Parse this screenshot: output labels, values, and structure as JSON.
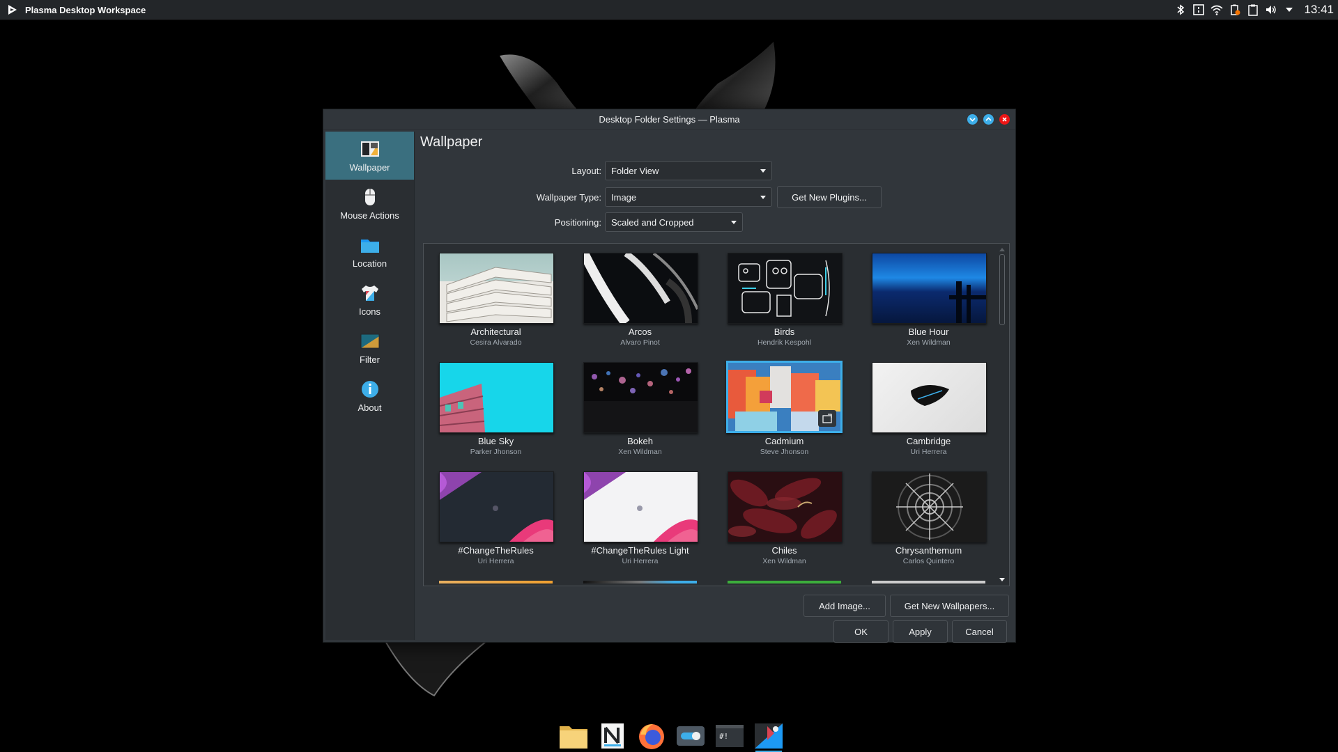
{
  "panel": {
    "app_title": "Plasma Desktop Workspace",
    "clock": "13:41",
    "tray_icons": [
      "bluetooth-icon",
      "notes-icon",
      "wifi-icon",
      "battery-icon",
      "clipboard-icon",
      "volume-icon",
      "expand-tray-icon"
    ]
  },
  "dialog": {
    "title": "Desktop Folder Settings — Plasma",
    "sidebar": [
      {
        "label": "Wallpaper",
        "icon": "wallpaper-icon",
        "active": true
      },
      {
        "label": "Mouse Actions",
        "icon": "mouse-icon",
        "active": false
      },
      {
        "label": "Location",
        "icon": "folder-icon",
        "active": false
      },
      {
        "label": "Icons",
        "icon": "shirt-icon",
        "active": false
      },
      {
        "label": "Filter",
        "icon": "filter-icon",
        "active": false
      },
      {
        "label": "About",
        "icon": "info-icon",
        "active": false
      }
    ],
    "heading": "Wallpaper",
    "form": {
      "layout_label": "Layout:",
      "layout_value": "Folder View",
      "type_label": "Wallpaper Type:",
      "type_value": "Image",
      "get_plugins": "Get New Plugins...",
      "positioning_label": "Positioning:",
      "positioning_value": "Scaled and Cropped"
    },
    "wallpapers": [
      {
        "name": "Architectural",
        "author": "Cesira Alvarado"
      },
      {
        "name": "Arcos",
        "author": "Alvaro Pinot"
      },
      {
        "name": "Birds",
        "author": "Hendrik Kespohl"
      },
      {
        "name": "Blue Hour",
        "author": "Xen Wildman"
      },
      {
        "name": "Blue Sky",
        "author": "Parker Jhonson"
      },
      {
        "name": "Bokeh",
        "author": "Xen Wildman"
      },
      {
        "name": "Cadmium",
        "author": "Steve Jhonson",
        "selected": true
      },
      {
        "name": "Cambridge",
        "author": "Uri Herrera"
      },
      {
        "name": "#ChangeTheRules",
        "author": "Uri Herrera"
      },
      {
        "name": "#ChangeTheRules Light",
        "author": "Uri Herrera"
      },
      {
        "name": "Chiles",
        "author": "Xen Wildman"
      },
      {
        "name": "Chrysanthemum",
        "author": "Carlos Quintero"
      }
    ],
    "buttons": {
      "add_image": "Add Image...",
      "get_wallpapers": "Get New Wallpapers...",
      "ok": "OK",
      "apply": "Apply",
      "cancel": "Cancel"
    }
  },
  "dock": [
    "file-manager-icon",
    "notes-app-icon",
    "firefox-icon",
    "settings-toggle-icon",
    "terminal-icon",
    "plasma-app-icon"
  ],
  "colors": {
    "accent": "#3daee9",
    "sidebar_active": "#3a6f7f",
    "window": "#31363b"
  }
}
